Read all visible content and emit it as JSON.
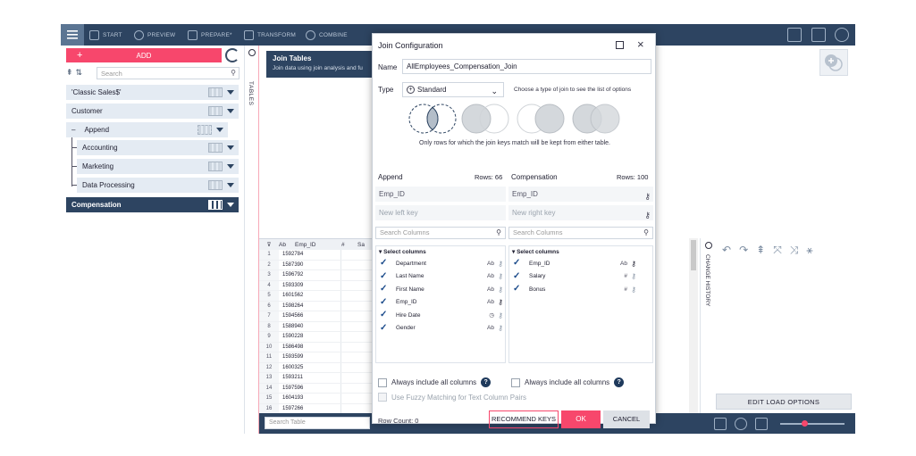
{
  "toolbar": {
    "items": [
      "START",
      "PREVIEW",
      "PREPARE*",
      "TRANSFORM",
      "COMBINE"
    ]
  },
  "left": {
    "add_label": "ADD",
    "search_placeholder": "Search",
    "tables": [
      {
        "label": "'Classic Sales$'"
      },
      {
        "label": "Customer"
      },
      {
        "label": "Append"
      },
      {
        "label": "Accounting"
      },
      {
        "label": "Marketing"
      },
      {
        "label": "Data Processing"
      },
      {
        "label": "Compensation"
      }
    ],
    "tables_tab": "TABLES"
  },
  "join_tables": {
    "title": "Join Tables",
    "subtitle": "Join data using join analysis and fu"
  },
  "grid": {
    "col_type": "Ab",
    "col_name": "Emp_ID",
    "col2_type": "#",
    "col2_name": "Sa",
    "rows": [
      {
        "n": "1",
        "v": "1592784"
      },
      {
        "n": "2",
        "v": "1587390"
      },
      {
        "n": "3",
        "v": "1596792"
      },
      {
        "n": "4",
        "v": "1593309"
      },
      {
        "n": "5",
        "v": "1601562"
      },
      {
        "n": "6",
        "v": "1598264"
      },
      {
        "n": "7",
        "v": "1594566"
      },
      {
        "n": "8",
        "v": "1588940"
      },
      {
        "n": "9",
        "v": "1590228"
      },
      {
        "n": "10",
        "v": "1586498"
      },
      {
        "n": "11",
        "v": "1593599"
      },
      {
        "n": "12",
        "v": "1600325"
      },
      {
        "n": "13",
        "v": "1593211"
      },
      {
        "n": "14",
        "v": "1597596"
      },
      {
        "n": "15",
        "v": "1604193"
      },
      {
        "n": "16",
        "v": "1597266"
      }
    ],
    "search_placeholder": "Search Table"
  },
  "right": {
    "change_history": "CHANGE HISTORY",
    "edit_load": "EDIT LOAD OPTIONS"
  },
  "dialog": {
    "title": "Join Configuration",
    "name_label": "Name",
    "name_value": "AllEmployees_Compensation_Join",
    "type_label": "Type",
    "type_value": "Standard",
    "type_hint": "Choose a type of join to see the list of options",
    "venn_caption": "Only rows for which the join keys match will be kept from either table.",
    "left_name": "Append",
    "left_rows": "Rows: 66",
    "right_name": "Compensation",
    "right_rows": "Rows: 100",
    "left_key": "Emp_ID",
    "right_key": "Emp_ID",
    "left_new_placeholder": "New left key",
    "right_new_placeholder": "New right key",
    "search_columns": "Search Columns",
    "select_columns": "Select columns",
    "left_columns": [
      {
        "name": "Department",
        "type": "Ab",
        "key": false
      },
      {
        "name": "Last Name",
        "type": "Ab",
        "key": false
      },
      {
        "name": "First Name",
        "type": "Ab",
        "key": false
      },
      {
        "name": "Emp_ID",
        "type": "Ab",
        "key": true
      },
      {
        "name": "Hire Date",
        "type": "clock",
        "key": false
      },
      {
        "name": "Gender",
        "type": "Ab",
        "key": false
      }
    ],
    "right_columns": [
      {
        "name": "Emp_ID",
        "type": "Ab",
        "key": true
      },
      {
        "name": "Salary",
        "type": "#",
        "key": false
      },
      {
        "name": "Bonus",
        "type": "#",
        "key": false
      }
    ],
    "always_include": "Always include all columns",
    "fuzzy": "Use Fuzzy Matching for Text Column Pairs",
    "row_count": "Row Count: 0",
    "recommend": "RECOMMEND KEYS",
    "ok": "OK",
    "cancel": "CANCEL"
  },
  "colors": {
    "accent": "#f7476c",
    "navy": "#2d4461",
    "light_row": "#e4ebf3"
  }
}
